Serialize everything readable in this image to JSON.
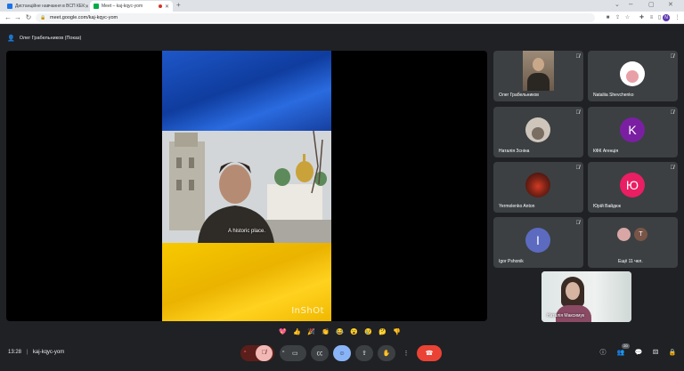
{
  "browser": {
    "tabs": [
      {
        "title": "Дистанційне навчання в ВСП КЕК",
        "favicon_color": "#1a73e8"
      },
      {
        "title": "Meet – kaj-kqyc-yom",
        "favicon_color": "#00ac47"
      }
    ],
    "new_tab": "+",
    "url": "meet.google.com/kaj-kqyc-yom",
    "profile_initial": "N"
  },
  "meet": {
    "presenter": "Олег Грабельников (Показ)",
    "subtitle": "A historic place.",
    "watermark": "InShOt",
    "time": "13:28",
    "meeting_code": "kaj-kqyc-yom",
    "participant_count": "20"
  },
  "participants": [
    {
      "name": "Олег Грабельников",
      "type": "photo",
      "colors": [
        "#6b5a4a",
        "#c9a88a"
      ]
    },
    {
      "name": "Nataliia Shevchenko",
      "type": "photo-round",
      "colors": [
        "#ffffff",
        "#e8a0a8"
      ]
    },
    {
      "name": "Наталія Зсніна",
      "type": "photo-round",
      "colors": [
        "#cfc6bb",
        "#7a6d62"
      ]
    },
    {
      "name": "КФК Агенція",
      "type": "letter",
      "letter": "K",
      "colors": [
        "#7b1fa2"
      ]
    },
    {
      "name": "Yermolenko Anton",
      "type": "photo-round",
      "colors": [
        "#4a1a14",
        "#d23a22"
      ]
    },
    {
      "name": "Юрій Вайдюк",
      "type": "letter",
      "letter": "Ю",
      "colors": [
        "#e91e63"
      ]
    },
    {
      "name": "Igor Pshonik",
      "type": "letter",
      "letter": "I",
      "colors": [
        "#5c6bc0"
      ]
    },
    {
      "name": "Ещё 11 чел.",
      "type": "group",
      "letter": "T",
      "colors": [
        "#d9a6a6",
        "#795548"
      ]
    }
  ],
  "self_view": {
    "name": "Наталія Максимук"
  },
  "reactions": [
    "💖",
    "👍",
    "🎉",
    "👏",
    "😂",
    "😮",
    "😢",
    "🤔",
    "👎"
  ],
  "controls": {
    "mic": "mic-off",
    "end_call": "end-call"
  }
}
